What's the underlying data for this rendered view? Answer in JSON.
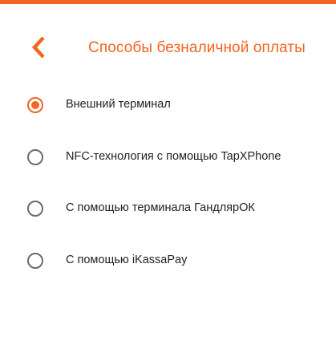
{
  "colors": {
    "accent": "#f26522",
    "text": "#222222",
    "radio_unchecked": "#6b6b6b"
  },
  "header": {
    "back_icon": "chevron-left-icon",
    "title": "Способы безналичной оплаты"
  },
  "payment_methods": {
    "selected_index": 0,
    "options": [
      {
        "label": "Внешний терминал",
        "checked": true
      },
      {
        "label": "NFC-технология с помощью TapXPhone",
        "checked": false
      },
      {
        "label": "С помощью терминала ГандлярОК",
        "checked": false
      },
      {
        "label": "С помощью iKassaPay",
        "checked": false
      }
    ]
  }
}
